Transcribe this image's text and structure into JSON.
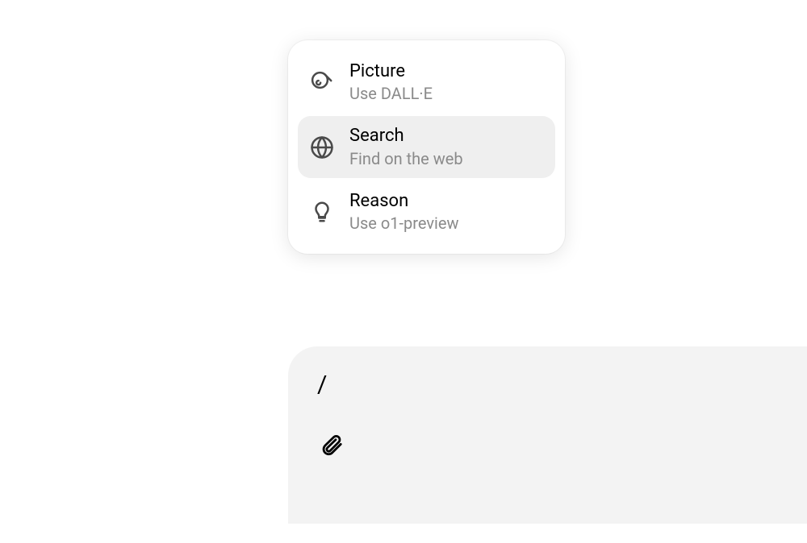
{
  "menu": {
    "items": [
      {
        "title": "Picture",
        "subtitle": "Use DALL·E",
        "icon": "brush-icon",
        "selected": false
      },
      {
        "title": "Search",
        "subtitle": "Find on the web",
        "icon": "globe-icon",
        "selected": true
      },
      {
        "title": "Reason",
        "subtitle": "Use o1-preview",
        "icon": "lightbulb-icon",
        "selected": false
      }
    ]
  },
  "input": {
    "value": "/"
  }
}
